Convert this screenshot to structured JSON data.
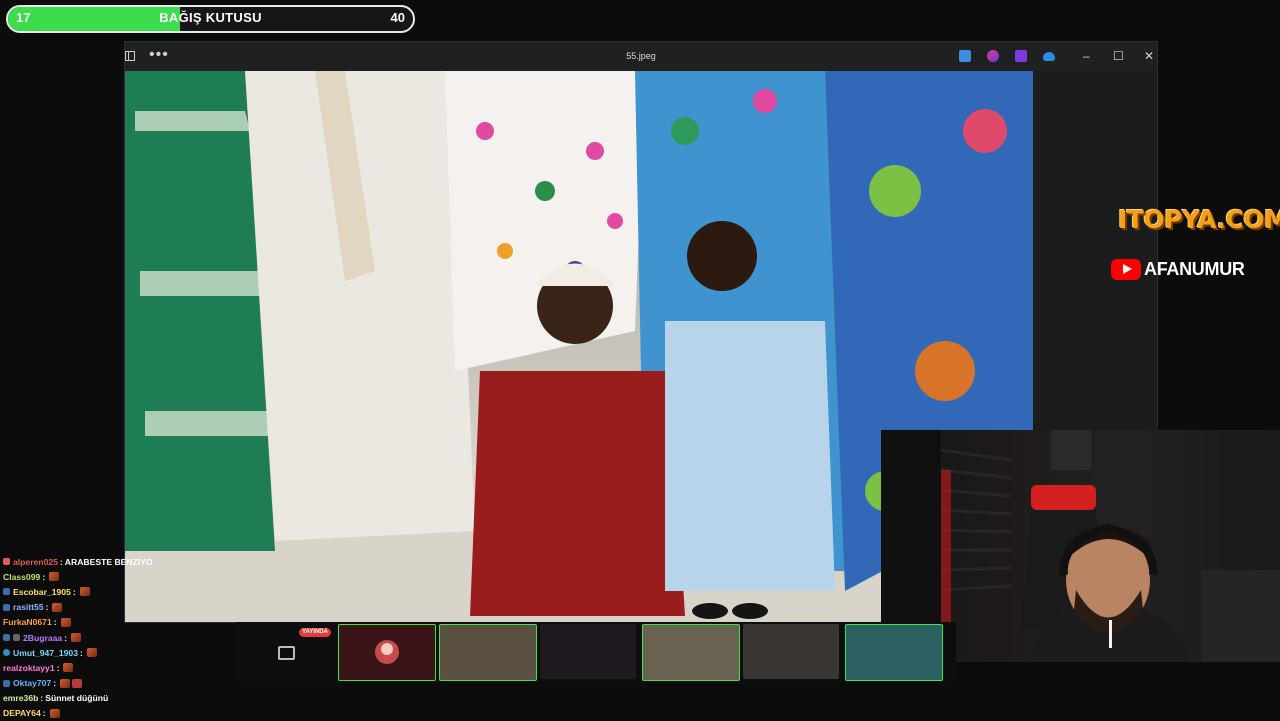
{
  "donation": {
    "title": "BAĞIŞ KUTUSU",
    "current": "17",
    "goal": "40",
    "fill_fraction": 0.425,
    "color": "#3ddc4c"
  },
  "viewer": {
    "file_title": "55.jpeg",
    "more_label": "•••",
    "minimize": "–",
    "maximize": "☐",
    "close": "✕"
  },
  "branding": {
    "logo": "ITOPYA.COM",
    "channel": "AFANUMUR"
  },
  "chat": {
    "messages": [
      {
        "user": "alperen025",
        "color": "#e05b5b",
        "text": "ARABESTE BENZIYO",
        "badge": false
      },
      {
        "user": "Class099",
        "color": "#bfe36a",
        "text": "",
        "badge": true
      },
      {
        "user": "Escobar_1905",
        "color": "#ffe066",
        "text": "",
        "badge": true
      },
      {
        "user": "rasitt55",
        "color": "#8bb8ff",
        "text": "",
        "badge": true
      },
      {
        "user": "FurkaN0671",
        "color": "#ff9f43",
        "text": "",
        "badge": true
      },
      {
        "user": "2Bugraaa",
        "color": "#b07cff",
        "text": "",
        "badge": true
      },
      {
        "user": "Umut_947_1903",
        "color": "#7fd4ff",
        "text": "",
        "badge": true
      },
      {
        "user": "realzoktayy1",
        "color": "#ff7ad9",
        "text": "",
        "badge": true
      },
      {
        "user": "Oktay707",
        "color": "#66b3ff",
        "text": "",
        "badge": true
      },
      {
        "user": "emre36b",
        "color": "#c7f0a0",
        "text": "Sünnet düğünü",
        "badge": false
      },
      {
        "user": "DEPAY64",
        "color": "#ffd966",
        "text": "",
        "badge": true
      }
    ]
  },
  "strip": {
    "live_label": "YAYINDA"
  }
}
